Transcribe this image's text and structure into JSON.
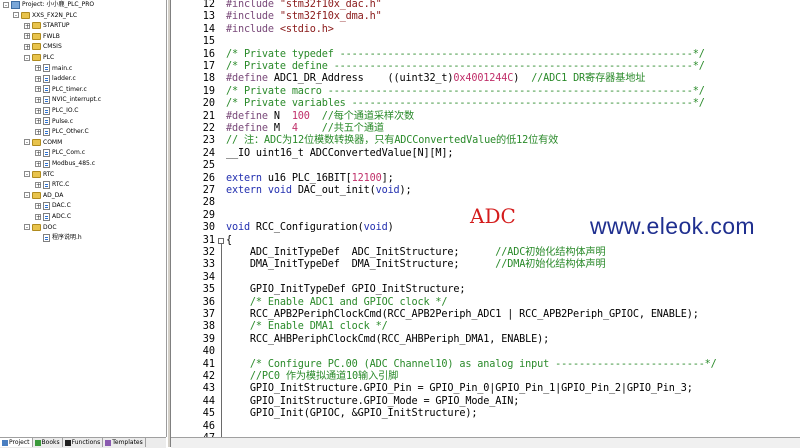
{
  "project_tree": [
    {
      "label": "Project: 小小鹿_PLC_PRO",
      "level": 0,
      "kind": "root",
      "expander": "-"
    },
    {
      "label": "XXS_FX2N_PLC",
      "level": 1,
      "kind": "folder",
      "expander": "-"
    },
    {
      "label": "STARTUP",
      "level": 2,
      "kind": "folder",
      "expander": "+"
    },
    {
      "label": "FWLB",
      "level": 2,
      "kind": "folder",
      "expander": "+"
    },
    {
      "label": "CMSIS",
      "level": 2,
      "kind": "folder",
      "expander": "+"
    },
    {
      "label": "PLC",
      "level": 2,
      "kind": "folder",
      "expander": "-"
    },
    {
      "label": "main.c",
      "level": 3,
      "kind": "file",
      "expander": "+"
    },
    {
      "label": "ladder.c",
      "level": 3,
      "kind": "file",
      "expander": "+"
    },
    {
      "label": "PLC_timer.c",
      "level": 3,
      "kind": "file",
      "expander": "+"
    },
    {
      "label": "NVIC_interrupt.c",
      "level": 3,
      "kind": "file",
      "expander": "+"
    },
    {
      "label": "PLC_IO.C",
      "level": 3,
      "kind": "file",
      "expander": "+"
    },
    {
      "label": "Pulse.c",
      "level": 3,
      "kind": "file",
      "expander": "+"
    },
    {
      "label": "PLC_Other.C",
      "level": 3,
      "kind": "file",
      "expander": "+"
    },
    {
      "label": "COMM",
      "level": 2,
      "kind": "folder",
      "expander": "-"
    },
    {
      "label": "PLC_Com.c",
      "level": 3,
      "kind": "file",
      "expander": "+"
    },
    {
      "label": "Modbus_485.c",
      "level": 3,
      "kind": "file",
      "expander": "+"
    },
    {
      "label": "RTC",
      "level": 2,
      "kind": "folder",
      "expander": "-"
    },
    {
      "label": "RTC.C",
      "level": 3,
      "kind": "file",
      "expander": "+"
    },
    {
      "label": "AD_DA",
      "level": 2,
      "kind": "folder",
      "expander": "-"
    },
    {
      "label": "DAC.C",
      "level": 3,
      "kind": "file",
      "expander": "+"
    },
    {
      "label": "ADC.C",
      "level": 3,
      "kind": "file",
      "expander": "+"
    },
    {
      "label": "DOC",
      "level": 2,
      "kind": "folder",
      "expander": "-"
    },
    {
      "label": "程序说明.h",
      "level": 3,
      "kind": "file",
      "expander": ""
    }
  ],
  "bottom_tabs": [
    {
      "label": "Project",
      "icon": "project-icon",
      "active": true
    },
    {
      "label": "Books",
      "icon": "books-icon",
      "active": false
    },
    {
      "label": "Functions",
      "icon": "functions-icon",
      "active": false
    },
    {
      "label": "Templates",
      "icon": "templates-icon",
      "active": false
    }
  ],
  "code_lines": [
    {
      "n": "12",
      "tokens": [
        [
          "pp",
          "#include "
        ],
        [
          "str",
          "\"stm32f10x_dac.h\""
        ]
      ]
    },
    {
      "n": "13",
      "tokens": [
        [
          "pp",
          "#include "
        ],
        [
          "str",
          "\"stm32f10x_dma.h\""
        ]
      ]
    },
    {
      "n": "14",
      "tokens": [
        [
          "pp",
          "#include "
        ],
        [
          "str",
          "<stdio.h>"
        ]
      ]
    },
    {
      "n": "15",
      "tokens": []
    },
    {
      "n": "16",
      "tokens": [
        [
          "cm",
          "/* Private typedef -----------------------------------------------------------*/"
        ]
      ]
    },
    {
      "n": "17",
      "tokens": [
        [
          "cm",
          "/* Private define ------------------------------------------------------------*/"
        ]
      ]
    },
    {
      "n": "18",
      "tokens": [
        [
          "pp",
          "#define "
        ],
        [
          "d",
          "ADC1_DR_Address    ((uint32_t)"
        ],
        [
          "num",
          "0x4001244C"
        ],
        [
          "d",
          ")  "
        ],
        [
          "cm",
          "//ADC1 DR寄存器基地址"
        ]
      ]
    },
    {
      "n": "19",
      "tokens": [
        [
          "cm",
          "/* Private macro -------------------------------------------------------------*/"
        ]
      ]
    },
    {
      "n": "20",
      "tokens": [
        [
          "cm",
          "/* Private variables ---------------------------------------------------------*/"
        ]
      ]
    },
    {
      "n": "21",
      "tokens": [
        [
          "pp",
          "#define "
        ],
        [
          "d",
          "N  "
        ],
        [
          "num",
          "100"
        ],
        [
          "d",
          "  "
        ],
        [
          "cm",
          "//每个通道采样次数"
        ]
      ]
    },
    {
      "n": "22",
      "tokens": [
        [
          "pp",
          "#define "
        ],
        [
          "d",
          "M  "
        ],
        [
          "num",
          "4"
        ],
        [
          "d",
          "    "
        ],
        [
          "cm",
          "//共五个通道"
        ]
      ]
    },
    {
      "n": "23",
      "tokens": [
        [
          "cm",
          "// 注：ADC为12位模数转换器，只有ADCConvertedValue的低12位有效"
        ]
      ]
    },
    {
      "n": "24",
      "tokens": [
        [
          "d",
          "__IO uint16_t ADCConvertedValue[N][M];"
        ]
      ]
    },
    {
      "n": "25",
      "tokens": []
    },
    {
      "n": "26",
      "tokens": [
        [
          "kw",
          "extern "
        ],
        [
          "d",
          "u16 PLC_16BIT["
        ],
        [
          "num",
          "12100"
        ],
        [
          "d",
          "];"
        ]
      ]
    },
    {
      "n": "27",
      "tokens": [
        [
          "kw",
          "extern void "
        ],
        [
          "d",
          "DAC_out_init("
        ],
        [
          "kw",
          "void"
        ],
        [
          "d",
          ");"
        ]
      ]
    },
    {
      "n": "28",
      "tokens": []
    },
    {
      "n": "29",
      "tokens": []
    },
    {
      "n": "30",
      "tokens": [
        [
          "kw",
          "void "
        ],
        [
          "d",
          "RCC_Configuration("
        ],
        [
          "kw",
          "void"
        ],
        [
          "d",
          ")"
        ]
      ]
    },
    {
      "n": "31",
      "tokens": [
        [
          "d",
          "{"
        ]
      ]
    },
    {
      "n": "32",
      "tokens": [
        [
          "d",
          "    ADC_InitTypeDef  ADC_InitStructure;      "
        ],
        [
          "cm",
          "//ADC初始化结构体声明"
        ]
      ]
    },
    {
      "n": "33",
      "tokens": [
        [
          "d",
          "    DMA_InitTypeDef  DMA_InitStructure;      "
        ],
        [
          "cm",
          "//DMA初始化结构体声明"
        ]
      ]
    },
    {
      "n": "34",
      "tokens": []
    },
    {
      "n": "35",
      "tokens": [
        [
          "d",
          "    GPIO_InitTypeDef GPIO_InitStructure;"
        ]
      ]
    },
    {
      "n": "36",
      "tokens": [
        [
          "cm",
          "    /* Enable ADC1 and GPIOC clock */"
        ]
      ]
    },
    {
      "n": "37",
      "tokens": [
        [
          "d",
          "    RCC_APB2PeriphClockCmd(RCC_APB2Periph_ADC1 | RCC_APB2Periph_GPIOC, ENABLE);"
        ]
      ]
    },
    {
      "n": "38",
      "tokens": [
        [
          "cm",
          "    /* Enable DMA1 clock */"
        ]
      ]
    },
    {
      "n": "39",
      "tokens": [
        [
          "d",
          "    RCC_AHBPeriphClockCmd(RCC_AHBPeriph_DMA1, ENABLE);"
        ]
      ]
    },
    {
      "n": "40",
      "tokens": []
    },
    {
      "n": "41",
      "tokens": [
        [
          "cm",
          "    /* Configure PC.00 (ADC Channel10) as analog input -------------------------*/"
        ]
      ]
    },
    {
      "n": "42",
      "tokens": [
        [
          "cm",
          "    //PC0 作为模拟通道10输入引脚"
        ]
      ]
    },
    {
      "n": "43",
      "tokens": [
        [
          "d",
          "    GPIO_InitStructure.GPIO_Pin = GPIO_Pin_0|GPIO_Pin_1|GPIO_Pin_2|GPIO_Pin_3;"
        ]
      ]
    },
    {
      "n": "44",
      "tokens": [
        [
          "d",
          "    GPIO_InitStructure.GPIO_Mode = GPIO_Mode_AIN;"
        ]
      ]
    },
    {
      "n": "45",
      "tokens": [
        [
          "d",
          "    GPIO_Init(GPIOC, &GPIO_InitStructure);"
        ]
      ]
    },
    {
      "n": "46",
      "tokens": []
    },
    {
      "n": "47",
      "tokens": []
    }
  ],
  "annotation": "ADC",
  "watermark": "www.eleok.com",
  "colors": {
    "preprocessor": "#7a4a7a",
    "keyword": "#2330b0",
    "string": "#8a1a1a",
    "comment": "#2a8a2a",
    "number": "#c0306a",
    "annotation": "#d41c1c",
    "watermark": "#1f2f8f"
  }
}
